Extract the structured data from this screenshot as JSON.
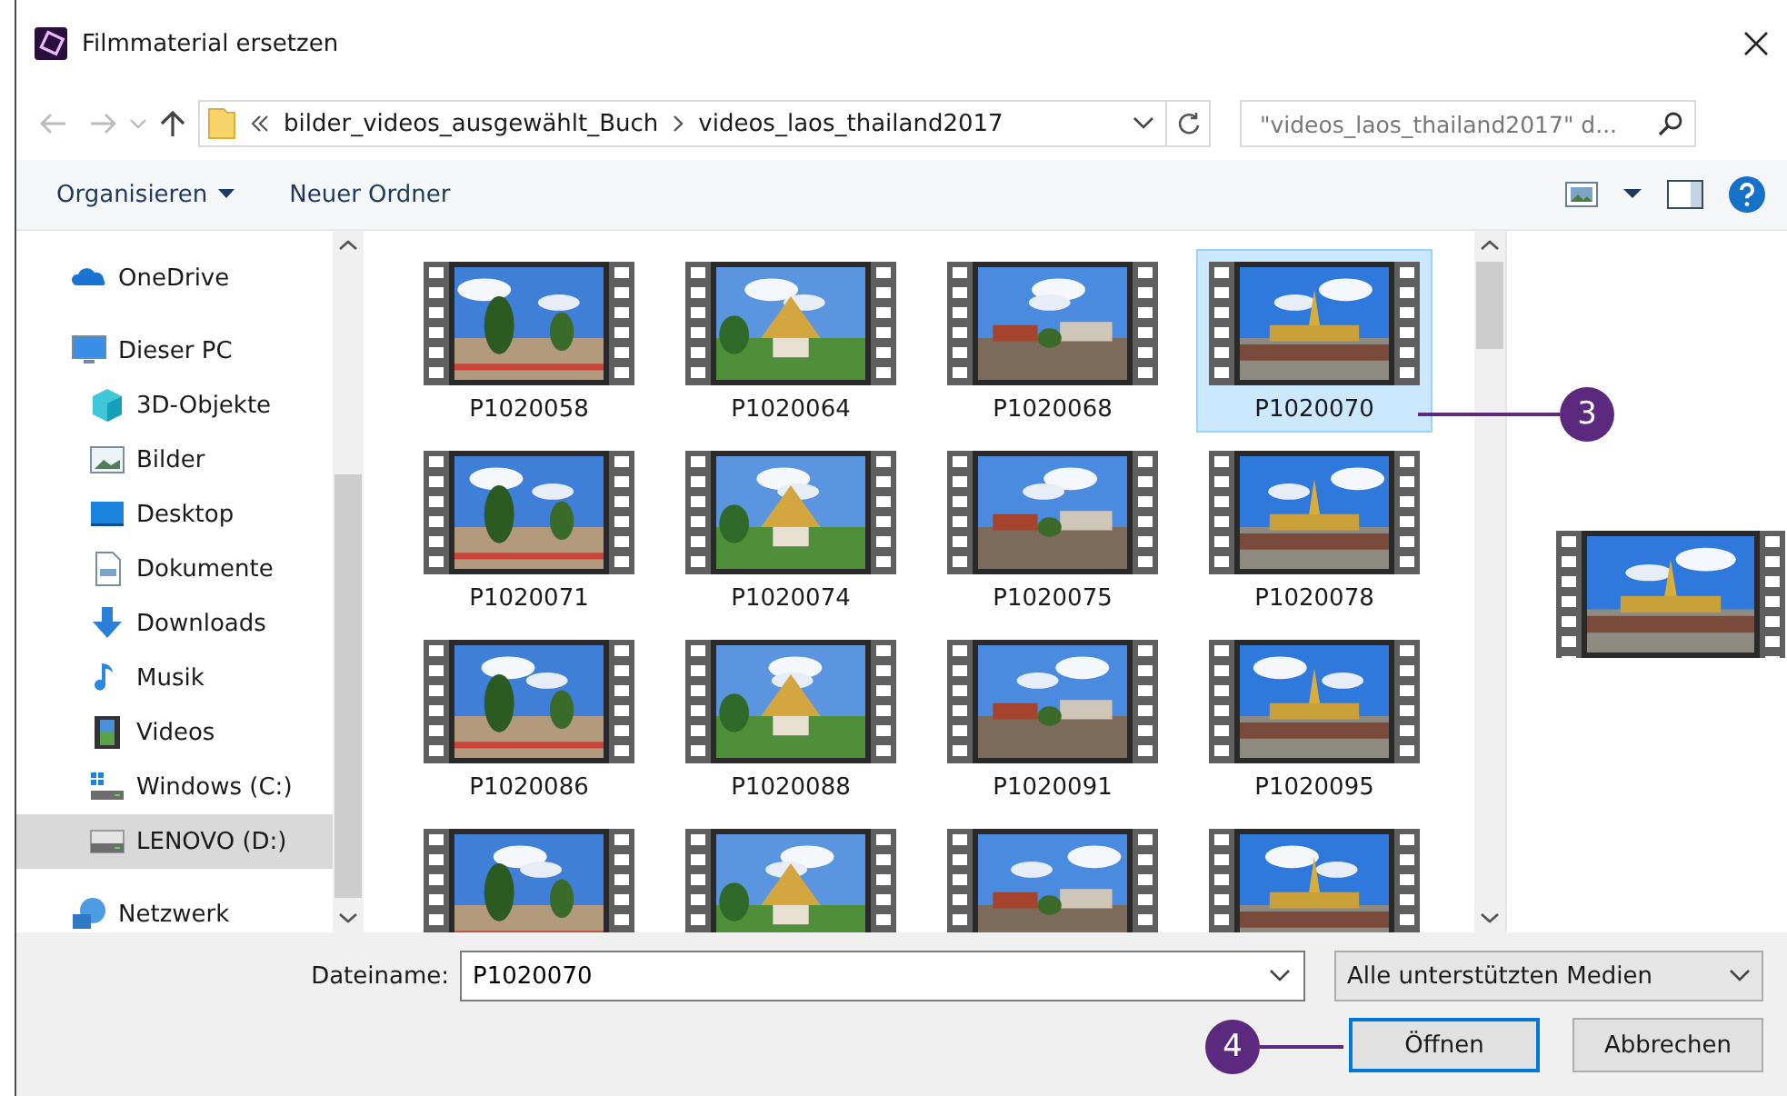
{
  "window": {
    "title": "Filmmaterial ersetzen"
  },
  "address": {
    "crumbs": [
      "bilder_videos_ausgewählt_Buch",
      "videos_laos_thailand2017"
    ]
  },
  "search": {
    "placeholder": "\"videos_laos_thailand2017\" d..."
  },
  "toolbar": {
    "organize": "Organisieren",
    "new_folder": "Neuer Ordner"
  },
  "sidebar": {
    "items": [
      {
        "label": "OneDrive",
        "kind": "onedrive",
        "selected": false
      },
      {
        "label": "Dieser PC",
        "kind": "pc",
        "selected": false,
        "children": [
          {
            "label": "3D-Objekte",
            "kind": "cube",
            "selected": false
          },
          {
            "label": "Bilder",
            "kind": "pictures",
            "selected": false
          },
          {
            "label": "Desktop",
            "kind": "desktop",
            "selected": false
          },
          {
            "label": "Dokumente",
            "kind": "documents",
            "selected": false
          },
          {
            "label": "Downloads",
            "kind": "downloads",
            "selected": false
          },
          {
            "label": "Musik",
            "kind": "music",
            "selected": false
          },
          {
            "label": "Videos",
            "kind": "videos",
            "selected": false
          },
          {
            "label": "Windows (C:)",
            "kind": "windows-drive",
            "selected": false
          },
          {
            "label": "LENOVO (D:)",
            "kind": "drive",
            "selected": true
          }
        ]
      },
      {
        "label": "Netzwerk",
        "kind": "network",
        "selected": false
      }
    ]
  },
  "files": [
    {
      "name": "P1020058",
      "selected": false
    },
    {
      "name": "P1020064",
      "selected": false
    },
    {
      "name": "P1020068",
      "selected": false
    },
    {
      "name": "P1020070",
      "selected": true
    },
    {
      "name": "P1020071",
      "selected": false
    },
    {
      "name": "P1020074",
      "selected": false
    },
    {
      "name": "P1020075",
      "selected": false
    },
    {
      "name": "P1020078",
      "selected": false
    },
    {
      "name": "P1020086",
      "selected": false
    },
    {
      "name": "P1020088",
      "selected": false
    },
    {
      "name": "P1020091",
      "selected": false
    },
    {
      "name": "P1020095",
      "selected": false
    },
    {
      "selected": false
    },
    {
      "selected": false
    },
    {
      "selected": false
    },
    {
      "selected": false
    }
  ],
  "filename": {
    "label": "Dateiname:",
    "value": "P1020070"
  },
  "filter": {
    "value": "Alle unterstützten Medien"
  },
  "buttons": [
    {
      "label": "Öffnen",
      "kind": "default"
    },
    {
      "label": "Abbrechen",
      "kind": "normal"
    }
  ],
  "callouts": [
    {
      "number": "3"
    },
    {
      "number": "4"
    }
  ]
}
